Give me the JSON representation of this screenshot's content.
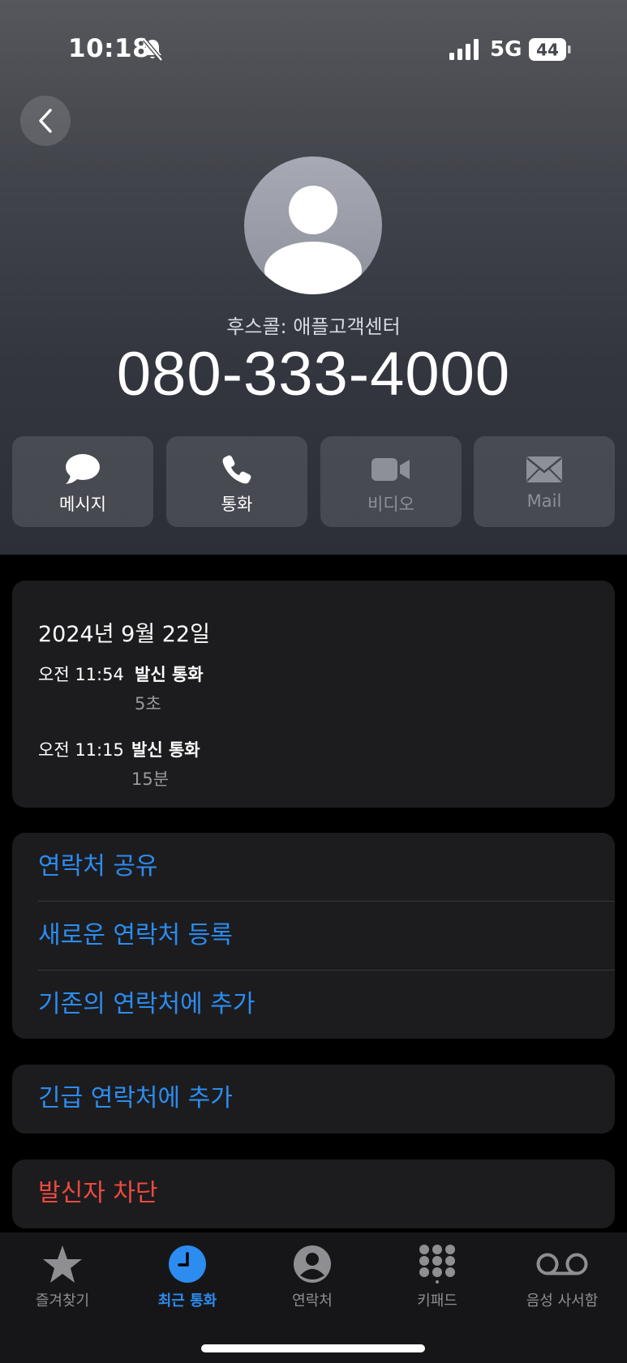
{
  "status_bar": {
    "time": "10:18",
    "network": "5G",
    "battery": "44"
  },
  "contact": {
    "caller_label": "후스콜: 애플고객센터",
    "number": "080-333-4000"
  },
  "actions": [
    {
      "label": "메시지",
      "icon": "message-bubble-icon",
      "enabled": true
    },
    {
      "label": "통화",
      "icon": "phone-icon",
      "enabled": true
    },
    {
      "label": "비디오",
      "icon": "video-camera-icon",
      "enabled": false
    },
    {
      "label": "Mail",
      "icon": "mail-envelope-icon",
      "enabled": false
    }
  ],
  "history": {
    "date": "2024년 9월 22일",
    "calls": [
      {
        "time": "오전 11:54",
        "type": "발신 통화",
        "duration": "5초"
      },
      {
        "time": "오전 11:15",
        "type": "발신 통화",
        "duration": "15분"
      }
    ]
  },
  "options": {
    "share_contact": "연락처 공유",
    "create_contact": "새로운 연락처 등록",
    "add_existing": "기존의 연락처에 추가",
    "add_emergency": "긴급 연락처에 추가",
    "block_caller": "발신자 차단"
  },
  "tabbar": [
    {
      "label": "즐겨찾기",
      "icon": "star-icon",
      "active": false
    },
    {
      "label": "최근 통화",
      "icon": "clock-icon",
      "active": true
    },
    {
      "label": "연락처",
      "icon": "person-circle-icon",
      "active": false
    },
    {
      "label": "키패드",
      "icon": "keypad-icon",
      "active": false
    },
    {
      "label": "음성 사서함",
      "icon": "voicemail-icon",
      "active": false
    }
  ],
  "colors": {
    "accent": "#2c8cf0",
    "destructive": "#eb4a3f",
    "card": "#1c1c1e"
  }
}
